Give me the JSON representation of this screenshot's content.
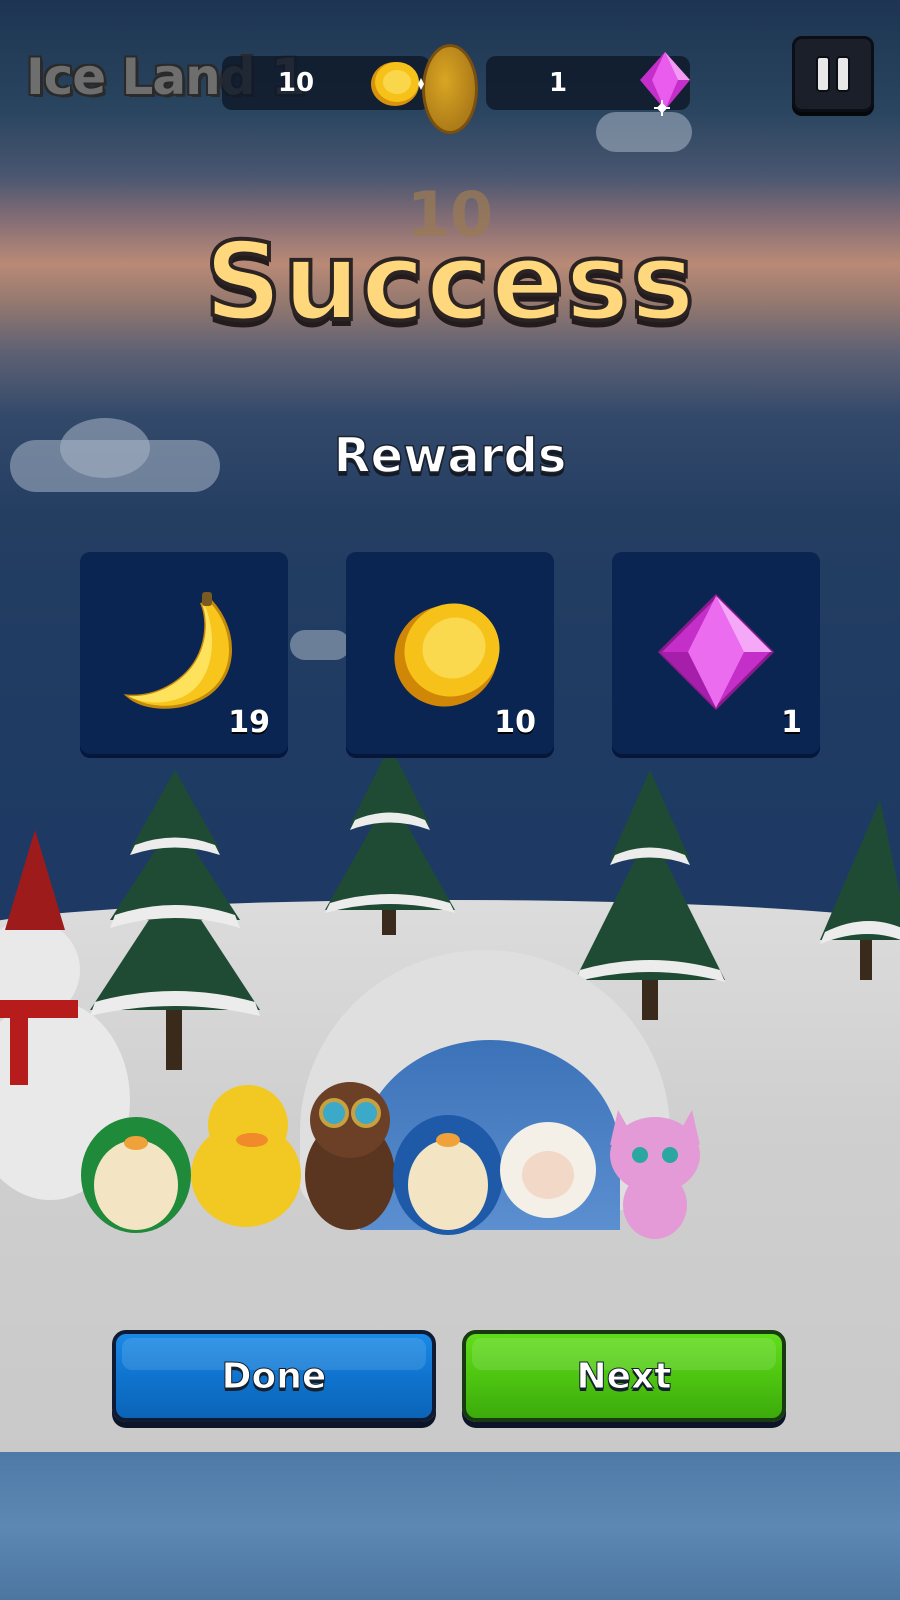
{
  "hud": {
    "level_title": "Ice Land 1",
    "coins": "10",
    "gems": "1"
  },
  "result": {
    "level_number": "10",
    "title": "Success",
    "rewards_heading": "Rewards"
  },
  "rewards": [
    {
      "item": "banana",
      "icon": "banana-icon",
      "count": "19"
    },
    {
      "item": "coin",
      "icon": "coin-icon",
      "count": "10"
    },
    {
      "item": "gem",
      "icon": "gem-icon",
      "count": "1"
    }
  ],
  "buttons": {
    "done_label": "Done",
    "next_label": "Next"
  },
  "colors": {
    "success_title": "#ffd77c",
    "reward_card": "#0b2553",
    "done_button": "#0f74cf",
    "next_button": "#4ec611",
    "gem": "#e43fe8",
    "coin": "#f6c21a"
  }
}
